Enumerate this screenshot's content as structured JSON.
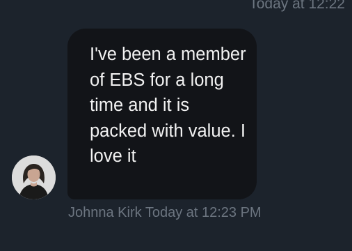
{
  "previous_message": {
    "timestamp": "Today at 12:22"
  },
  "message": {
    "text": "I've been a member of EBS for a long time and it is packed with value. I love it",
    "sender": "Johnna Kirk",
    "timestamp": "Today at 12:23 PM",
    "avatar_icon": "user-avatar-photo"
  },
  "colors": {
    "background": "#1c232c",
    "bubble": "#121418",
    "text": "#f2f2f2",
    "muted": "#6c7580"
  }
}
